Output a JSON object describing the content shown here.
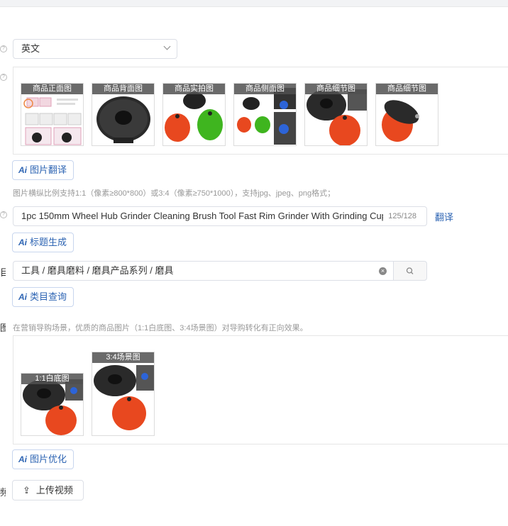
{
  "language": {
    "value": "英文"
  },
  "main_images": {
    "tags": [
      "商品正面图",
      "商品背面图",
      "商品实拍图",
      "商品侧面图",
      "商品细节图",
      "商品细节图"
    ]
  },
  "image_translate_button": {
    "ai": "Ai",
    "label": "图片翻译"
  },
  "image_hint": "图片横纵比例支持1:1（像素≥800*800）或3:4（像素≥750*1000），支持jpg、jpeg、png格式；",
  "title": {
    "value": "1pc 150mm Wheel Hub Grinder Cleaning Brush Tool Fast Rim Grinder With Grinding Cup Ca",
    "count": "125/128",
    "translate_link": "翻译"
  },
  "title_generate_button": {
    "ai": "Ai",
    "label": "标题生成"
  },
  "category": {
    "edge_label": "目",
    "value": "工具 / 磨具磨料 / 磨具产品系列 / 磨具"
  },
  "category_query_button": {
    "ai": "Ai",
    "label": "类目查询"
  },
  "marketing": {
    "edge_label": "图",
    "hint": "在营销导购场景，优质的商品图片（1:1白底图、3:4场景图）对导购转化有正向效果。",
    "tags": [
      "1:1白底图",
      "3:4场景图"
    ]
  },
  "image_optimize_button": {
    "ai": "Ai",
    "label": "图片优化"
  },
  "video": {
    "edge_label": "频",
    "upload_label": "上传视频"
  },
  "colors": {
    "accent": "#2d64b3",
    "orange": "#e8481f",
    "green": "#3fb51f",
    "dark": "#222222"
  }
}
